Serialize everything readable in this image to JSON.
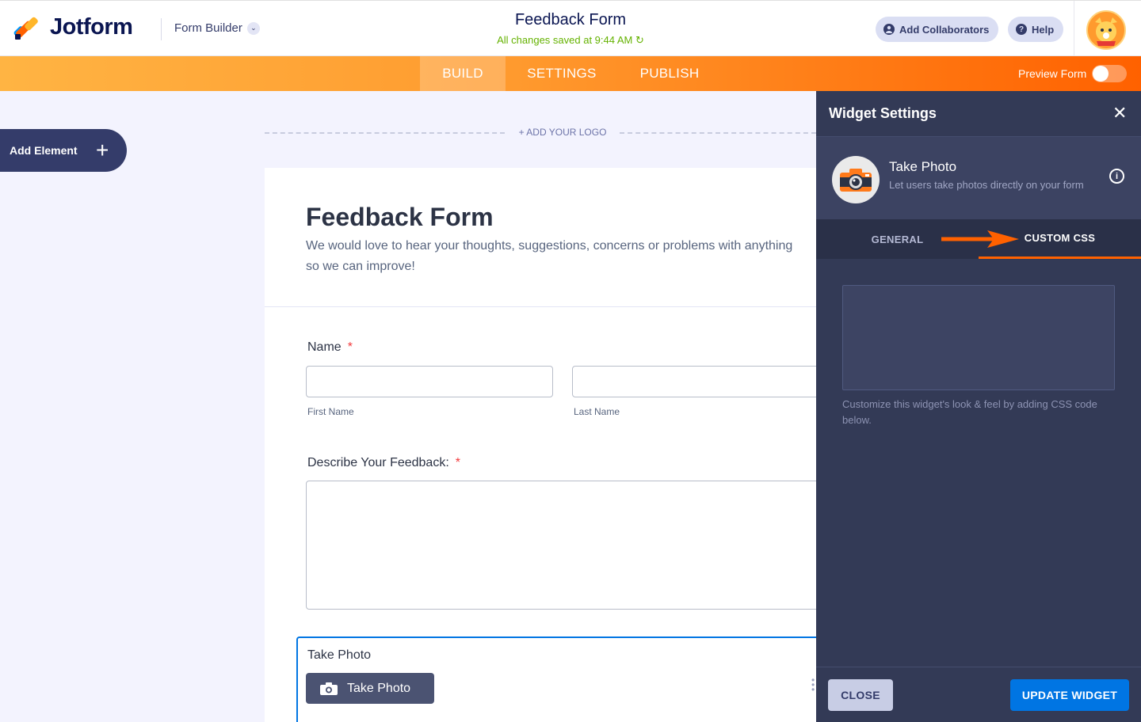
{
  "header": {
    "brand": "Jotform",
    "builder_switch": "Form Builder",
    "form_title": "Feedback Form",
    "save_status": "All changes saved at 9:44 AM",
    "add_collaborators": "Add Collaborators",
    "help": "Help"
  },
  "nav": {
    "tabs": [
      "BUILD",
      "SETTINGS",
      "PUBLISH"
    ],
    "active_tab": "BUILD",
    "preview_label": "Preview Form",
    "preview_on": false
  },
  "canvas": {
    "add_element": "Add Element",
    "add_logo": "+ ADD YOUR LOGO"
  },
  "form": {
    "title": "Feedback Form",
    "description": "We would love to hear your thoughts, suggestions, concerns or problems with anything so we can improve!",
    "name_label": "Name",
    "required_mark": "*",
    "first_name": "First Name",
    "last_name": "Last Name",
    "feedback_label": "Describe Your Feedback:",
    "photo_label": "Take Photo",
    "photo_button": "Take Photo"
  },
  "panel": {
    "title": "Widget Settings",
    "widget_name": "Take Photo",
    "widget_desc": "Let users take photos directly on your form",
    "tab_general": "GENERAL",
    "tab_css": "CUSTOM CSS",
    "css_help": "Customize this widget's look & feel by adding CSS code below.",
    "close_button": "CLOSE",
    "update_button": "UPDATE WIDGET"
  },
  "colors": {
    "brand_navy": "#0a1551",
    "orange": "#ff6100",
    "blue": "#0075e3",
    "panel_bg": "#333a56",
    "saved_green": "#64b200"
  }
}
